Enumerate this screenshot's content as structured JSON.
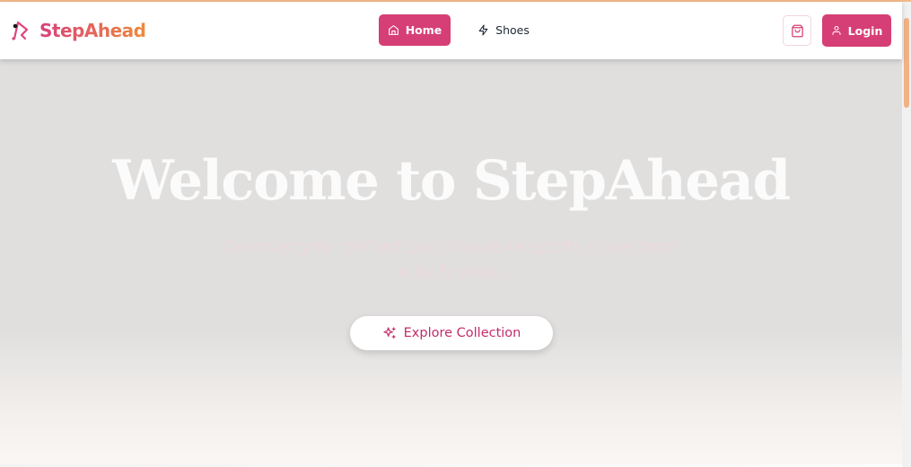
{
  "brand": {
    "name": "StepAhead",
    "gradient": [
      "#d9407a",
      "#ee8a3c"
    ]
  },
  "nav": {
    "items": [
      {
        "label": "Home",
        "icon": "home-icon",
        "active": true
      },
      {
        "label": "Shoes",
        "icon": "zap-icon",
        "active": false
      }
    ],
    "cart_icon": "shopping-bag-icon",
    "login_label": "Login",
    "login_icon": "user-icon"
  },
  "hero": {
    "title": "Welcome to StepAhead",
    "subtitle": "Discover your perfect pair. Exquisite sports shoes from elite brands.",
    "cta_label": "Explore Collection",
    "cta_icon": "sparkles-icon"
  },
  "colors": {
    "accent": "#d63f75",
    "cta_text": "#c42c6a",
    "hero_bg": "#e0dfde",
    "scroll_thumb": "#f2b287"
  }
}
